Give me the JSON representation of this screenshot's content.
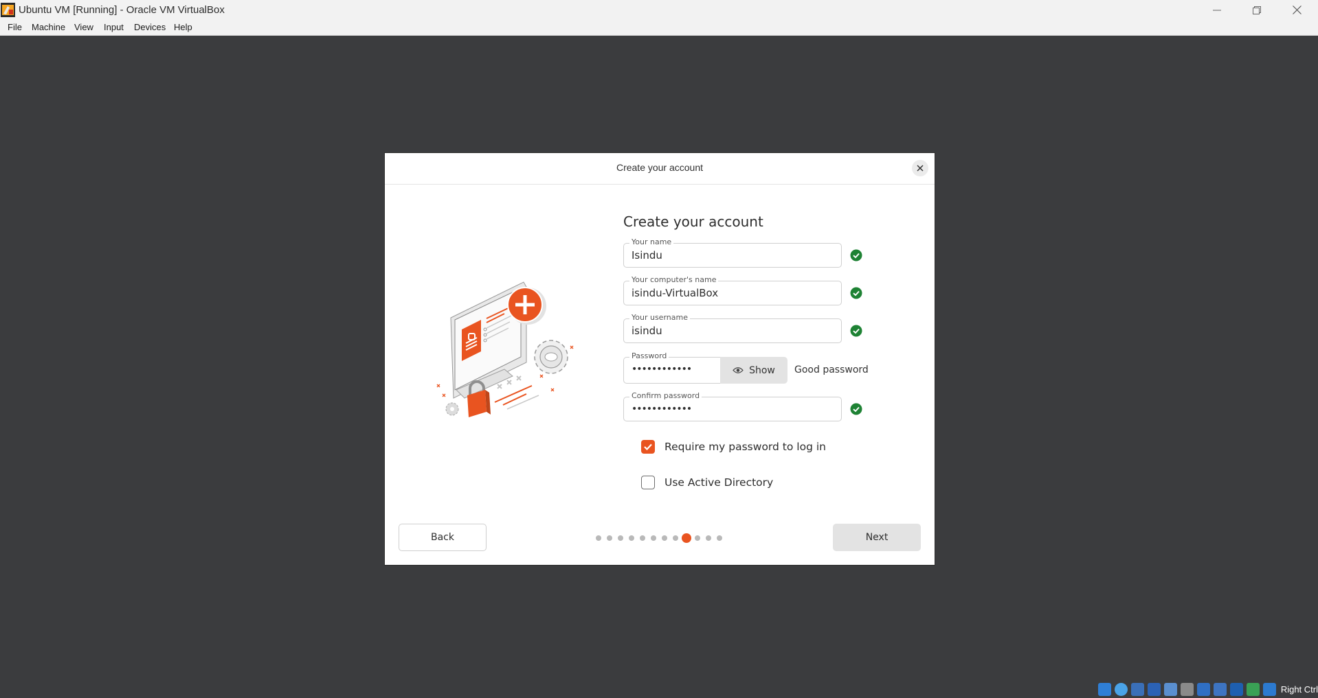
{
  "window": {
    "title": "Ubuntu VM [Running] - Oracle VM VirtualBox"
  },
  "menu": [
    "File",
    "Machine",
    "View",
    "Input",
    "Devices",
    "Help"
  ],
  "dialog": {
    "title": "Create your account",
    "heading": "Create your account",
    "fields": {
      "name": {
        "label": "Your name",
        "value": "Isindu"
      },
      "computer": {
        "label": "Your computer's name",
        "value": "isindu-VirtualBox"
      },
      "username": {
        "label": "Your username",
        "value": "isindu"
      },
      "password": {
        "label": "Password",
        "value": "••••••••••••",
        "show_label": "Show",
        "strength": "Good password"
      },
      "confirm": {
        "label": "Confirm password",
        "value": "••••••••••••"
      }
    },
    "options": {
      "require_password": {
        "label": "Require my password to log in",
        "checked": true
      },
      "active_directory": {
        "label": "Use Active Directory",
        "checked": false
      }
    },
    "back_label": "Back",
    "next_label": "Next",
    "pager": {
      "total": 12,
      "current": 9
    }
  },
  "colors": {
    "accent": "#e95420",
    "ok": "#1e8234",
    "background": "#3b3c3e"
  },
  "tray": {
    "host_key": "Right Ctrl"
  }
}
